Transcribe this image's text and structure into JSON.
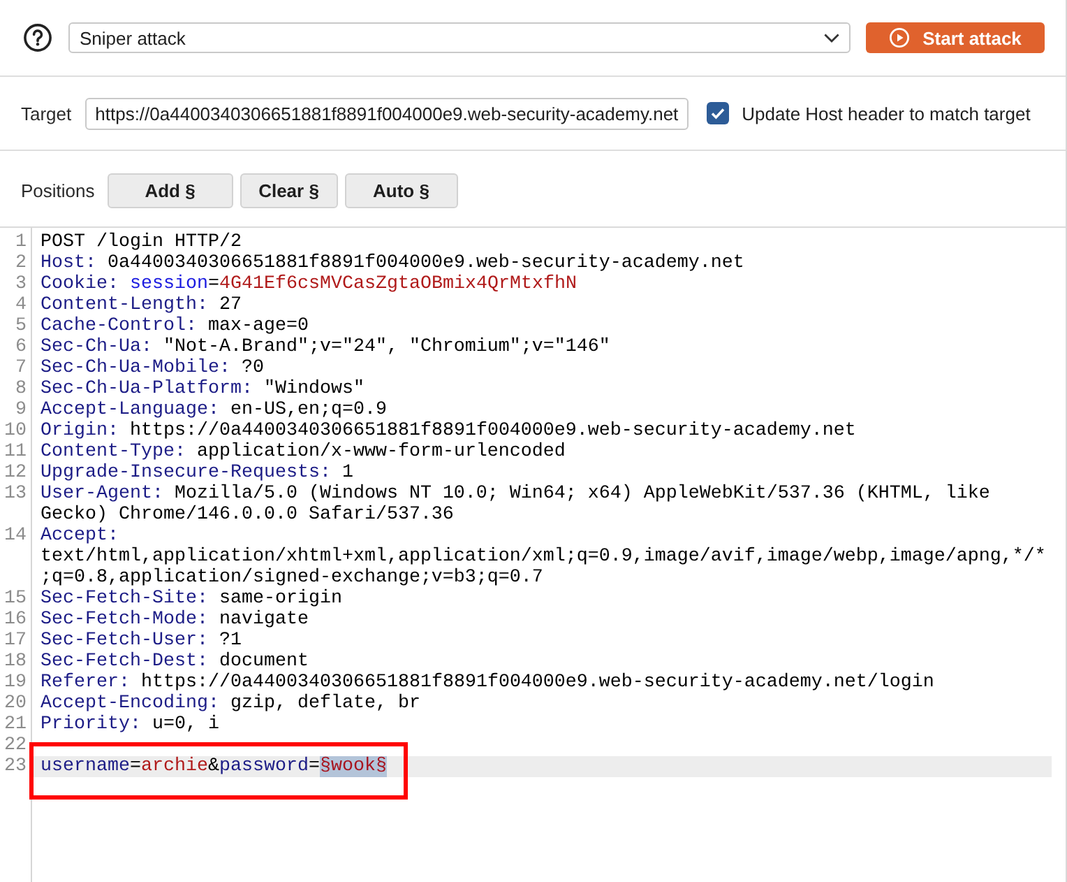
{
  "toolbar": {
    "attack_type": "Sniper attack",
    "start_button": "Start attack"
  },
  "target": {
    "label": "Target",
    "url": "https://0a4400340306651881f8891f004000e9.web-security-academy.net",
    "update_host": {
      "label": "Update Host header to match target",
      "checked": true
    }
  },
  "positions": {
    "label": "Positions",
    "buttons": [
      "Add §",
      "Clear §",
      "Auto §"
    ]
  },
  "editor": {
    "lines": [
      {
        "number": "1",
        "current": false,
        "outlined": false,
        "tokens": [
          {
            "kind": "text",
            "text": "POST /login HTTP/2"
          }
        ]
      },
      {
        "number": "2",
        "current": false,
        "outlined": false,
        "tokens": [
          {
            "kind": "name",
            "text": "Host:"
          },
          {
            "kind": "text",
            "text": " 0a4400340306651881f8891f004000e9.web-security-academy.net"
          }
        ]
      },
      {
        "number": "3",
        "current": false,
        "outlined": false,
        "tokens": [
          {
            "kind": "name",
            "text": "Cookie:"
          },
          {
            "kind": "cookie_name",
            "text": " session"
          },
          {
            "kind": "text",
            "text": "="
          },
          {
            "kind": "value",
            "text": "4G41Ef6csMVCasZgtaOBmix4QrMtxfhN"
          }
        ]
      },
      {
        "number": "4",
        "current": false,
        "outlined": false,
        "tokens": [
          {
            "kind": "name",
            "text": "Content-Length:"
          },
          {
            "kind": "text",
            "text": " 27"
          }
        ]
      },
      {
        "number": "5",
        "current": false,
        "outlined": false,
        "tokens": [
          {
            "kind": "name",
            "text": "Cache-Control:"
          },
          {
            "kind": "text",
            "text": " max-age=0"
          }
        ]
      },
      {
        "number": "6",
        "current": false,
        "outlined": false,
        "tokens": [
          {
            "kind": "name",
            "text": "Sec-Ch-Ua:"
          },
          {
            "kind": "text",
            "text": " \"Not-A.Brand\";v=\"24\", \"Chromium\";v=\"146\""
          }
        ]
      },
      {
        "number": "7",
        "current": false,
        "outlined": false,
        "tokens": [
          {
            "kind": "name",
            "text": "Sec-Ch-Ua-Mobile:"
          },
          {
            "kind": "text",
            "text": " ?0"
          }
        ]
      },
      {
        "number": "8",
        "current": false,
        "outlined": false,
        "tokens": [
          {
            "kind": "name",
            "text": "Sec-Ch-Ua-Platform:"
          },
          {
            "kind": "text",
            "text": " \"Windows\""
          }
        ]
      },
      {
        "number": "9",
        "current": false,
        "outlined": false,
        "tokens": [
          {
            "kind": "name",
            "text": "Accept-Language:"
          },
          {
            "kind": "text",
            "text": " en-US,en;q=0.9"
          }
        ]
      },
      {
        "number": "10",
        "current": false,
        "outlined": false,
        "tokens": [
          {
            "kind": "name",
            "text": "Origin:"
          },
          {
            "kind": "text",
            "text": " https://0a4400340306651881f8891f004000e9.web-security-academy.net"
          }
        ]
      },
      {
        "number": "11",
        "current": false,
        "outlined": false,
        "tokens": [
          {
            "kind": "name",
            "text": "Content-Type:"
          },
          {
            "kind": "text",
            "text": " application/x-www-form-urlencoded"
          }
        ]
      },
      {
        "number": "12",
        "current": false,
        "outlined": false,
        "tokens": [
          {
            "kind": "name",
            "text": "Upgrade-Insecure-Requests:"
          },
          {
            "kind": "text",
            "text": " 1"
          }
        ]
      },
      {
        "number": "13",
        "current": false,
        "outlined": false,
        "tokens": [
          {
            "kind": "name",
            "text": "User-Agent:"
          },
          {
            "kind": "text",
            "text": " Mozilla/5.0 (Windows NT 10.0; Win64; x64) AppleWebKit/537.36 (KHTML, like"
          }
        ],
        "wrapped": [
          "Gecko) Chrome/146.0.0.0 Safari/537.36"
        ]
      },
      {
        "number": "14",
        "current": false,
        "outlined": false,
        "tokens": [
          {
            "kind": "name",
            "text": "Accept:"
          }
        ],
        "wrapped": [
          "text/html,application/xhtml+xml,application/xml;q=0.9,image/avif,image/webp,image/apng,*/*",
          ";q=0.8,application/signed-exchange;v=b3;q=0.7"
        ]
      },
      {
        "number": "15",
        "current": false,
        "outlined": false,
        "tokens": [
          {
            "kind": "name",
            "text": "Sec-Fetch-Site:"
          },
          {
            "kind": "text",
            "text": " same-origin"
          }
        ]
      },
      {
        "number": "16",
        "current": false,
        "outlined": false,
        "tokens": [
          {
            "kind": "name",
            "text": "Sec-Fetch-Mode:"
          },
          {
            "kind": "text",
            "text": " navigate"
          }
        ]
      },
      {
        "number": "17",
        "current": false,
        "outlined": false,
        "tokens": [
          {
            "kind": "name",
            "text": "Sec-Fetch-User:"
          },
          {
            "kind": "text",
            "text": " ?1"
          }
        ]
      },
      {
        "number": "18",
        "current": false,
        "outlined": false,
        "tokens": [
          {
            "kind": "name",
            "text": "Sec-Fetch-Dest:"
          },
          {
            "kind": "text",
            "text": " document"
          }
        ]
      },
      {
        "number": "19",
        "current": false,
        "outlined": false,
        "tokens": [
          {
            "kind": "name",
            "text": "Referer:"
          },
          {
            "kind": "text",
            "text": " https://0a4400340306651881f8891f004000e9.web-security-academy.net/login"
          }
        ]
      },
      {
        "number": "20",
        "current": false,
        "outlined": false,
        "tokens": [
          {
            "kind": "name",
            "text": "Accept-Encoding:"
          },
          {
            "kind": "text",
            "text": " gzip, deflate, br"
          }
        ]
      },
      {
        "number": "21",
        "current": false,
        "outlined": false,
        "tokens": [
          {
            "kind": "name",
            "text": "Priority:"
          },
          {
            "kind": "text",
            "text": " u=0, i"
          }
        ]
      },
      {
        "number": "22",
        "current": false,
        "outlined": false
      },
      {
        "number": "23",
        "current": true,
        "outlined": true,
        "tokens": [
          {
            "kind": "name",
            "text": "username"
          },
          {
            "kind": "text",
            "text": "="
          },
          {
            "kind": "value",
            "text": "archie"
          },
          {
            "kind": "text",
            "text": "&"
          },
          {
            "kind": "name",
            "text": "password"
          },
          {
            "kind": "text",
            "text": "="
          },
          {
            "kind": "payload",
            "text": "§wook§"
          }
        ]
      }
    ]
  }
}
